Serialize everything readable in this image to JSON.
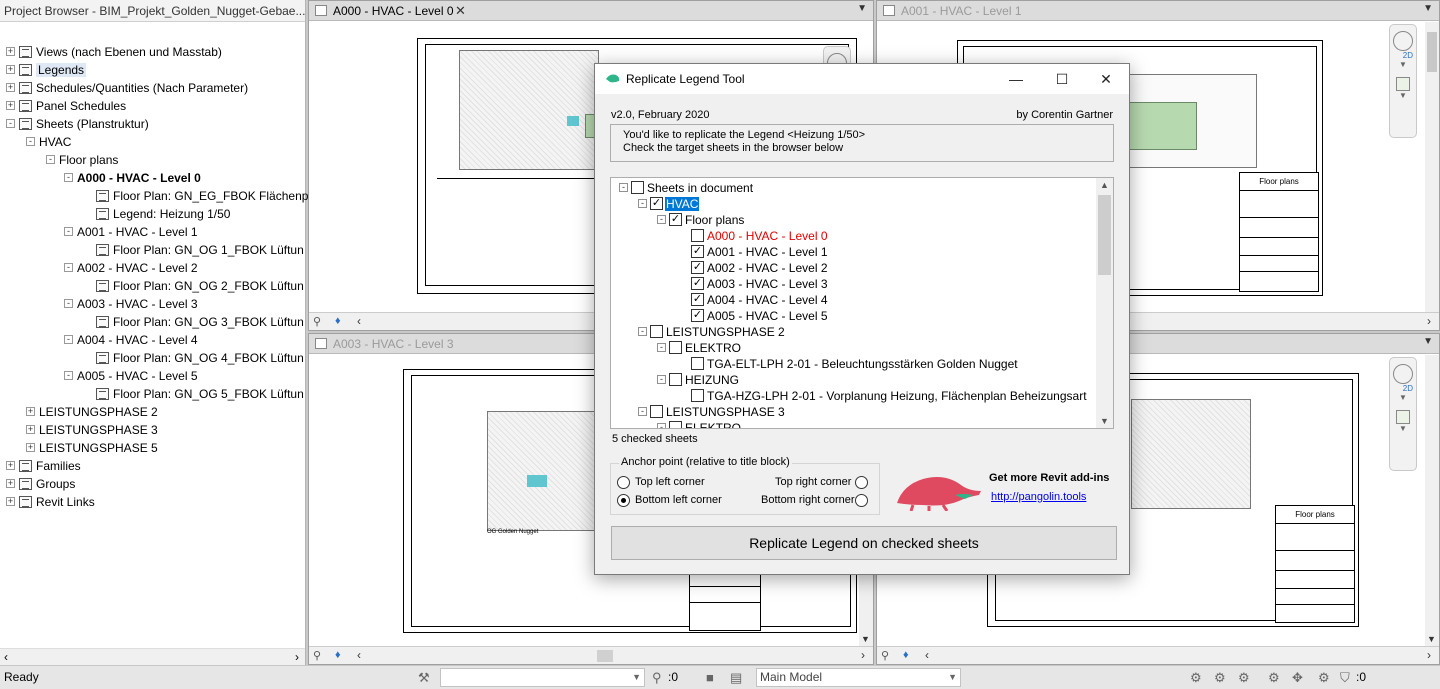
{
  "project_browser": {
    "title": "Project Browser - BIM_Projekt_Golden_Nugget-Gebae...",
    "items": [
      {
        "label": "Views (nach Ebenen und Masstab)",
        "indent": 0,
        "exp": "+",
        "icon": "views-icon"
      },
      {
        "label": "Legends",
        "indent": 0,
        "exp": "+",
        "icon": "legends-icon",
        "highlight": true
      },
      {
        "label": "Schedules/Quantities (Nach Parameter)",
        "indent": 0,
        "exp": "+",
        "icon": "schedules-icon"
      },
      {
        "label": "Panel Schedules",
        "indent": 0,
        "exp": "+",
        "icon": "panel-schedules-icon"
      },
      {
        "label": "Sheets (Planstruktur)",
        "indent": 0,
        "exp": "-",
        "icon": "sheets-icon"
      },
      {
        "label": "HVAC",
        "indent": 1,
        "exp": "-",
        "icon": ""
      },
      {
        "label": "Floor plans",
        "indent": 2,
        "exp": "-",
        "icon": ""
      },
      {
        "label": "A000 - HVAC - Level 0",
        "indent": 3,
        "exp": "-",
        "icon": "",
        "bold": true
      },
      {
        "label": "Floor Plan: GN_EG_FBOK Flächenp",
        "indent": 4,
        "exp": "",
        "icon": "sheet-view-icon"
      },
      {
        "label": "Legend: Heizung 1/50",
        "indent": 4,
        "exp": "",
        "icon": "legend-view-icon"
      },
      {
        "label": "A001 - HVAC - Level 1",
        "indent": 3,
        "exp": "-",
        "icon": ""
      },
      {
        "label": "Floor Plan: GN_OG 1_FBOK Lüftun",
        "indent": 4,
        "exp": "",
        "icon": "sheet-view-icon"
      },
      {
        "label": "A002 - HVAC - Level 2",
        "indent": 3,
        "exp": "-",
        "icon": ""
      },
      {
        "label": "Floor Plan: GN_OG 2_FBOK Lüftun",
        "indent": 4,
        "exp": "",
        "icon": "sheet-view-icon"
      },
      {
        "label": "A003 - HVAC - Level 3",
        "indent": 3,
        "exp": "-",
        "icon": ""
      },
      {
        "label": "Floor Plan: GN_OG 3_FBOK Lüftun",
        "indent": 4,
        "exp": "",
        "icon": "sheet-view-icon"
      },
      {
        "label": "A004 - HVAC - Level 4",
        "indent": 3,
        "exp": "-",
        "icon": ""
      },
      {
        "label": "Floor Plan: GN_OG 4_FBOK Lüftun",
        "indent": 4,
        "exp": "",
        "icon": "sheet-view-icon"
      },
      {
        "label": "A005 - HVAC - Level 5",
        "indent": 3,
        "exp": "-",
        "icon": ""
      },
      {
        "label": "Floor Plan: GN_OG 5_FBOK Lüftun",
        "indent": 4,
        "exp": "",
        "icon": "sheet-view-icon"
      },
      {
        "label": "LEISTUNGSPHASE 2",
        "indent": 1,
        "exp": "+",
        "icon": ""
      },
      {
        "label": "LEISTUNGSPHASE 3",
        "indent": 1,
        "exp": "+",
        "icon": ""
      },
      {
        "label": "LEISTUNGSPHASE 5",
        "indent": 1,
        "exp": "+",
        "icon": ""
      },
      {
        "label": "Families",
        "indent": 0,
        "exp": "+",
        "icon": "families-icon"
      },
      {
        "label": "Groups",
        "indent": 0,
        "exp": "+",
        "icon": "groups-icon"
      },
      {
        "label": "Revit Links",
        "indent": 0,
        "exp": "+",
        "icon": "revit-links-icon"
      }
    ]
  },
  "views": {
    "tl_tab": "A000 - HVAC - Level 0",
    "tr_tab": "A001 - HVAC - Level 1",
    "bl_tab": "A003 - HVAC - Level 3",
    "titleblock_label": "Floor plans",
    "plan_label": "OG Golden Nugget"
  },
  "status": {
    "ready": "Ready",
    "filter_count": ":0",
    "model": "Main Model",
    "selection_count": ":0"
  },
  "dialog": {
    "title": "Replicate Legend Tool",
    "version": "v2.0, February 2020",
    "author": "by Corentin Gartner",
    "info_line1": "You'd like to replicate the Legend <Heizung 1/50>",
    "info_line2": "Check the target sheets in the browser below",
    "tree": [
      {
        "label": "Sheets in document",
        "level": 0,
        "exp": "-",
        "checked": false
      },
      {
        "label": "HVAC",
        "level": 1,
        "exp": "-",
        "checked": true,
        "selected": true
      },
      {
        "label": "Floor plans",
        "level": 2,
        "exp": "-",
        "checked": true
      },
      {
        "label": "A000 - HVAC - Level 0",
        "level": 3,
        "exp": "",
        "checked": false,
        "red": true
      },
      {
        "label": "A001 - HVAC - Level 1",
        "level": 3,
        "exp": "",
        "checked": true
      },
      {
        "label": "A002 - HVAC - Level 2",
        "level": 3,
        "exp": "",
        "checked": true
      },
      {
        "label": "A003 - HVAC - Level 3",
        "level": 3,
        "exp": "",
        "checked": true
      },
      {
        "label": "A004 - HVAC - Level 4",
        "level": 3,
        "exp": "",
        "checked": true
      },
      {
        "label": "A005 - HVAC - Level 5",
        "level": 3,
        "exp": "",
        "checked": true
      },
      {
        "label": "LEISTUNGSPHASE 2",
        "level": 1,
        "exp": "-",
        "checked": false
      },
      {
        "label": "ELEKTRO",
        "level": 2,
        "exp": "-",
        "checked": false
      },
      {
        "label": "TGA-ELT-LPH 2-01 - Beleuchtungsstärken Golden Nugget",
        "level": 3,
        "exp": "",
        "checked": false
      },
      {
        "label": "HEIZUNG",
        "level": 2,
        "exp": "-",
        "checked": false
      },
      {
        "label": "TGA-HZG-LPH 2-01 - Vorplanung Heizung, Flächenplan Beheizungsart",
        "level": 3,
        "exp": "",
        "checked": false
      },
      {
        "label": "LEISTUNGSPHASE 3",
        "level": 1,
        "exp": "-",
        "checked": false
      },
      {
        "label": "ELEKTRO",
        "level": 2,
        "exp": "-",
        "checked": false
      }
    ],
    "count": "5 checked sheets",
    "anchor_legend": "Anchor point (relative to title block)",
    "anchor_tl": "Top left corner",
    "anchor_tr": "Top right corner",
    "anchor_bl": "Bottom left corner",
    "anchor_br": "Bottom right corner",
    "ad_title": "Get more Revit add-ins",
    "ad_link": "http://pangolin.tools",
    "button": "Replicate Legend on checked sheets",
    "brand_color": "#e04a60",
    "accent_color": "#2fb58a"
  }
}
